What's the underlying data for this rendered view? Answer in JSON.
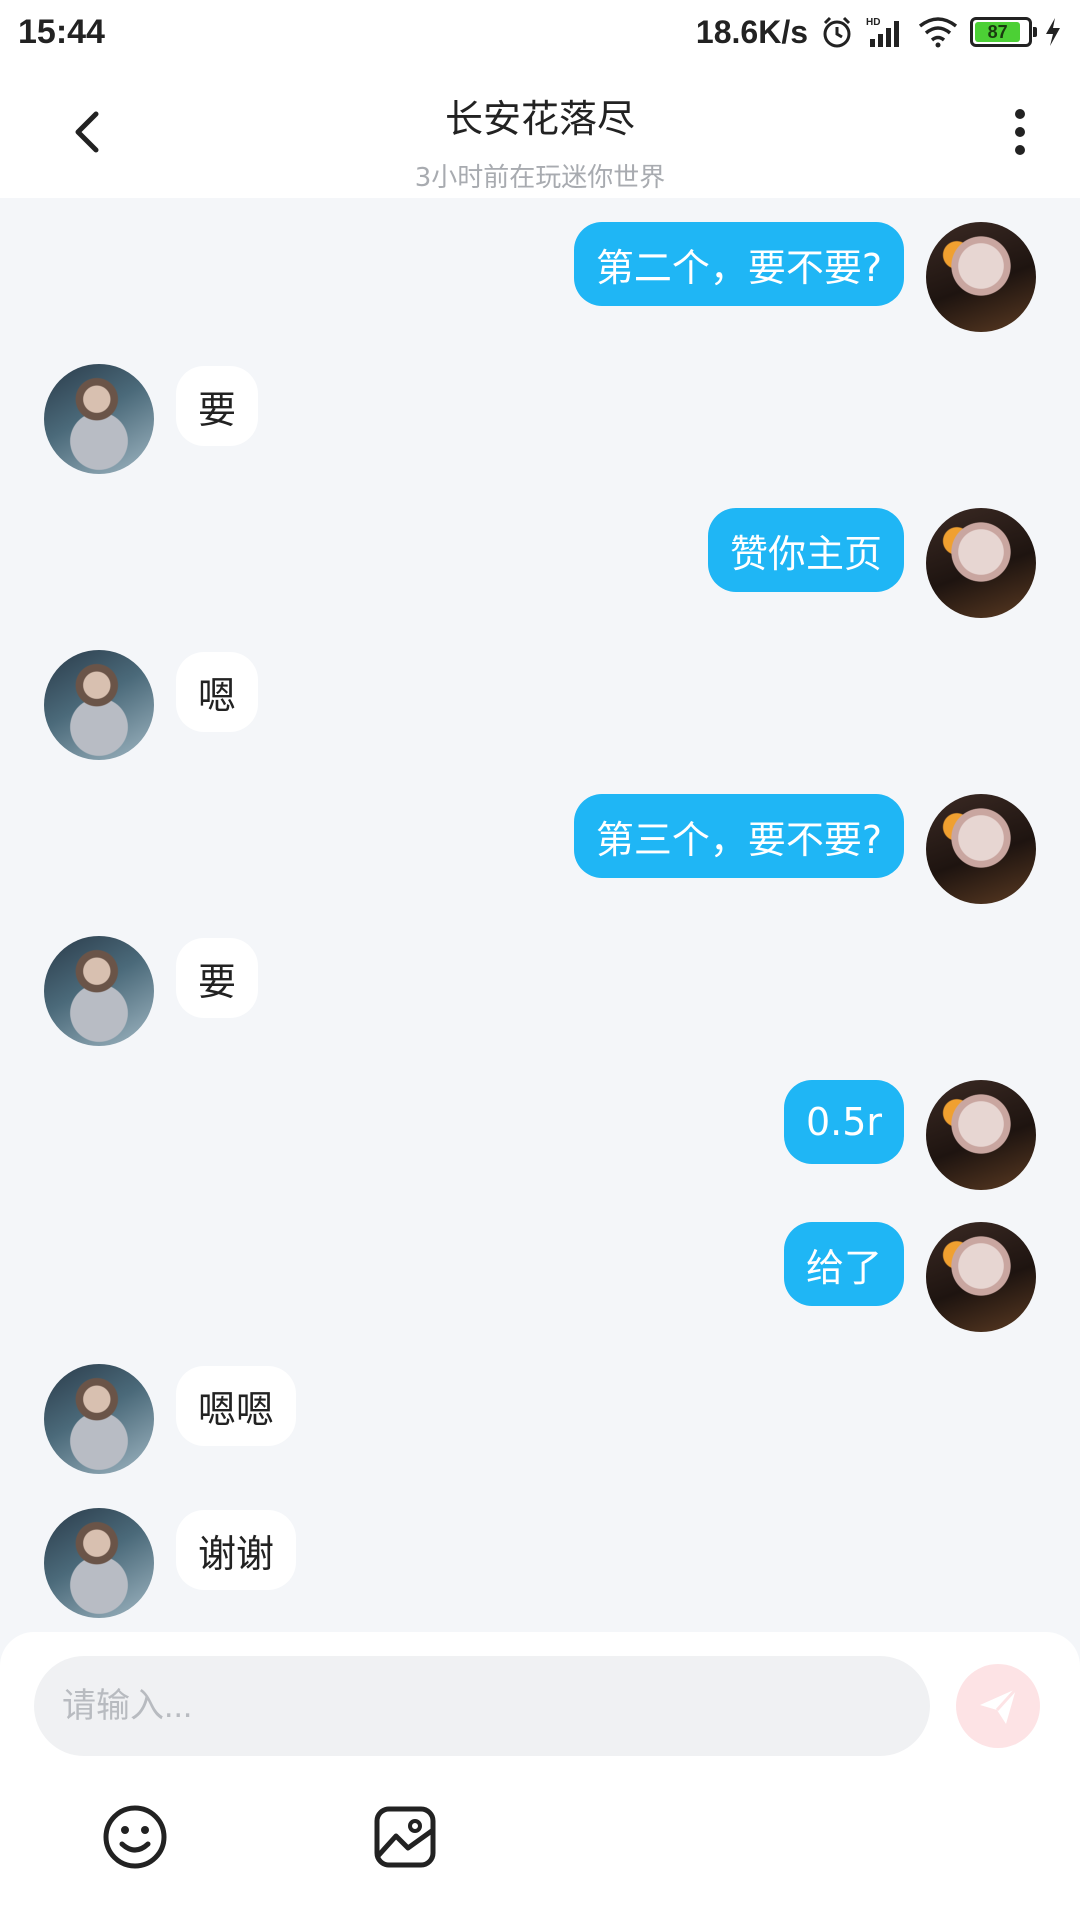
{
  "status_bar": {
    "time": "15:44",
    "network_speed": "18.6K/s",
    "battery_level": "87",
    "icons": [
      "alarm-icon",
      "hd-signal-icon",
      "wifi-icon",
      "battery-icon",
      "charging-icon"
    ]
  },
  "header": {
    "title": "长安花落尽",
    "subtitle": "3小时前在玩迷你世界",
    "icons": [
      "back-arrow-icon",
      "more-vertical-icon"
    ]
  },
  "messages": [
    {
      "from": "me",
      "text": "第二个，要不要?"
    },
    {
      "from": "other",
      "text": "要"
    },
    {
      "from": "me",
      "text": "赞你主页"
    },
    {
      "from": "other",
      "text": "嗯"
    },
    {
      "from": "me",
      "text": "第三个，要不要?"
    },
    {
      "from": "other",
      "text": "要"
    },
    {
      "from": "me",
      "text": "0.5r"
    },
    {
      "from": "me",
      "text": "给了"
    },
    {
      "from": "other",
      "text": "嗯嗯"
    },
    {
      "from": "other",
      "text": "谢谢"
    }
  ],
  "composer": {
    "placeholder": "请输入...",
    "value": "",
    "icons": [
      "send-icon",
      "emoji-icon",
      "image-icon"
    ]
  },
  "colors": {
    "outgoing_bubble": "#1fb6f5",
    "incoming_bubble": "#ffffff",
    "chat_background": "#f4f6f9",
    "send_button_disabled": "#fde3e5"
  }
}
